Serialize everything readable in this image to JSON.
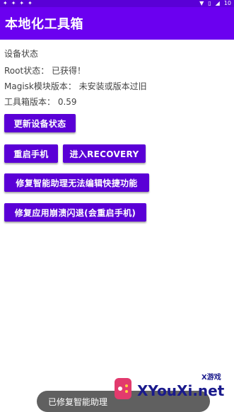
{
  "status_bar": {
    "left_icons": [
      "app-icon-1",
      "app-icon-2",
      "app-icon-3",
      "app-icon-4"
    ],
    "right_text": "10"
  },
  "app_bar": {
    "title": "本地化工具箱"
  },
  "device": {
    "section_label": "设备状态",
    "root_line": "Root状态： 已获得！",
    "magisk_line": "Magisk模块版本： 未安装或版本过旧",
    "toolbox_line": "工具箱版本： 0.59"
  },
  "buttons": {
    "refresh": "更新设备状态",
    "reboot": "重启手机",
    "recovery": "进入RECOVERY",
    "fix_assistant": "修复智能助理无法编辑快捷功能",
    "fix_crash": "修复应用崩溃闪退(会重启手机)"
  },
  "toast": {
    "text": "已修复智能助理"
  },
  "watermark": {
    "brand": "XYouXi.net",
    "sub": "X游戏"
  },
  "colors": {
    "primary": "#6b00f0",
    "primary_dark": "#5a00d6",
    "button": "#5a00d6"
  }
}
